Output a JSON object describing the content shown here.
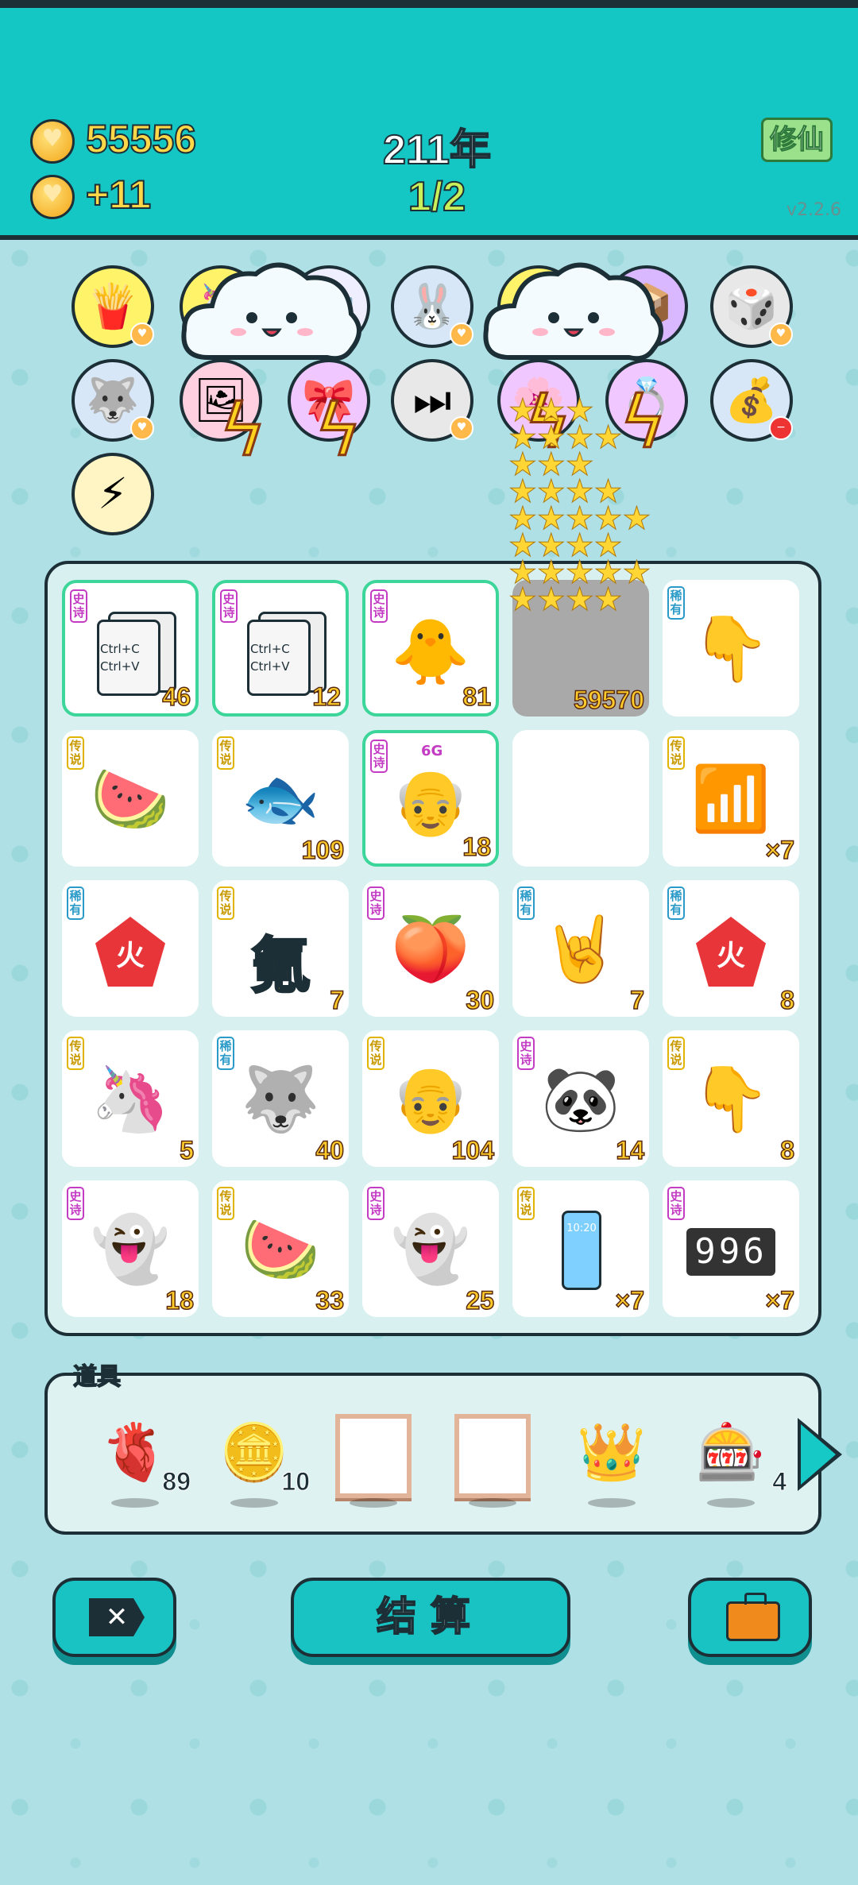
{
  "header": {
    "coins": "55556",
    "coin_income": "+11",
    "year": "211年",
    "round": "1/2",
    "mode_button": "修仙",
    "version": "v2.2.6"
  },
  "equipped_items": [
    {
      "icon": "fries-icon"
    },
    {
      "icon": "unicorn-icon"
    },
    {
      "icon": "rabbit-icon"
    },
    {
      "icon": "sun-icon"
    },
    {
      "icon": "item-icon"
    },
    {
      "icon": "dice-icon"
    },
    {
      "icon": "husky-icon"
    },
    {
      "icon": "poster-icon"
    },
    {
      "icon": "skip-icon"
    },
    {
      "icon": "item-icon"
    },
    {
      "icon": "money-bag-icon"
    },
    {
      "icon": "lightning-icon"
    }
  ],
  "board": [
    {
      "tag": "史诗",
      "rarity": "epic",
      "icon": "copy-paste-card-icon",
      "text": "Ctrl+C Ctrl+V",
      "count": "46"
    },
    {
      "tag": "史诗",
      "rarity": "epic",
      "icon": "copy-paste-card-icon",
      "text": "Ctrl+C Ctrl+V",
      "count": "12"
    },
    {
      "tag": "史诗",
      "rarity": "epic",
      "icon": "king-chick-icon",
      "count": "81"
    },
    {
      "tag": "",
      "rarity": "none",
      "icon": "empty-grey-icon",
      "count": "59570"
    },
    {
      "tag": "稀有",
      "rarity": "rare",
      "icon": "pointing-hand-icon",
      "count": ""
    },
    {
      "tag": "传说",
      "rarity": "legend",
      "icon": "watermelon-icon",
      "count": ""
    },
    {
      "tag": "传说",
      "rarity": "legend",
      "icon": "koi-icon",
      "count": "109"
    },
    {
      "tag": "史诗",
      "rarity": "epic",
      "icon": "king-old-man-icon",
      "count": "18",
      "badge": "6G"
    },
    {
      "tag": "",
      "rarity": "none",
      "icon": "empty-icon",
      "count": ""
    },
    {
      "tag": "传说",
      "rarity": "legend",
      "icon": "wifi-icon",
      "count": "×7"
    },
    {
      "tag": "稀有",
      "rarity": "rare",
      "icon": "fire-pentagon-icon",
      "text": "火",
      "count": ""
    },
    {
      "tag": "传说",
      "rarity": "legend",
      "icon": "chinese-char-icon",
      "text": "氪",
      "count": "7"
    },
    {
      "tag": "史诗",
      "rarity": "epic",
      "icon": "peach-icon",
      "count": "30"
    },
    {
      "tag": "稀有",
      "rarity": "rare",
      "icon": "rock-hand-icon",
      "count": "7"
    },
    {
      "tag": "稀有",
      "rarity": "rare",
      "icon": "fire-pentagon-icon",
      "text": "火",
      "count": "8"
    },
    {
      "tag": "传说",
      "rarity": "legend",
      "icon": "unicorn-icon",
      "count": "5"
    },
    {
      "tag": "稀有",
      "rarity": "rare",
      "icon": "husky-icon",
      "count": "40"
    },
    {
      "tag": "传说",
      "rarity": "legend",
      "icon": "king-grandpa-icon",
      "count": "104"
    },
    {
      "tag": "史诗",
      "rarity": "epic",
      "icon": "panda-icon",
      "count": "14"
    },
    {
      "tag": "传说",
      "rarity": "legend",
      "icon": "yellow-hand-icon",
      "count": "8"
    },
    {
      "tag": "史诗",
      "rarity": "epic",
      "icon": "ghost-icon",
      "count": "18"
    },
    {
      "tag": "传说",
      "rarity": "legend",
      "icon": "watermelon-icon",
      "count": "33"
    },
    {
      "tag": "史诗",
      "rarity": "epic",
      "icon": "ghost-icon",
      "count": "25"
    },
    {
      "tag": "传说",
      "rarity": "legend",
      "icon": "phone-icon",
      "text": "10:20",
      "count": "×7"
    },
    {
      "tag": "史诗",
      "rarity": "epic",
      "icon": "counter-996-icon",
      "text": "996",
      "count": "×7"
    }
  ],
  "props": {
    "label": "道具",
    "items": [
      {
        "icon": "liver-icon",
        "count": "89"
      },
      {
        "icon": "dollar-coin-icon",
        "count": "10"
      },
      {
        "icon": "frame-icon",
        "count": ""
      },
      {
        "icon": "frame-icon",
        "count": ""
      },
      {
        "icon": "crown-icon",
        "count": ""
      },
      {
        "icon": "slot-machine-icon",
        "count": "4"
      }
    ]
  },
  "buttons": {
    "settle": "结算"
  },
  "colors": {
    "header": "#14c6c4",
    "epic": "#c43bc4",
    "legend": "#e0b400",
    "rare": "#2a9ac8",
    "count": "#ffcc2a"
  }
}
